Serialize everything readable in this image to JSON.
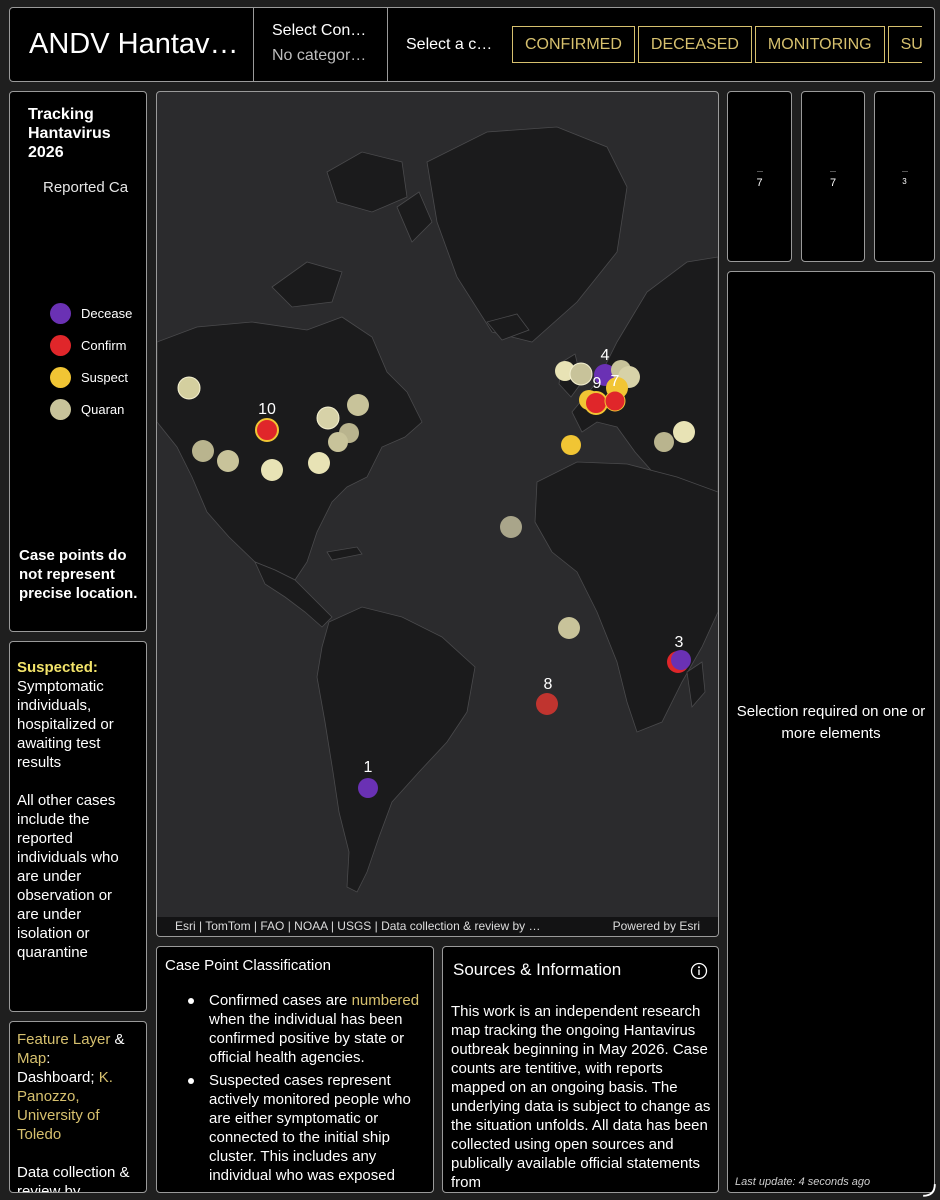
{
  "header": {
    "title": "ANDV Hantav…",
    "selector_one": {
      "label": "Select Con…",
      "value": "No categor…"
    },
    "selector_two": {
      "label": "Select a c…"
    },
    "category_buttons": [
      "CONFIRMED",
      "DECEASED",
      "MONITORING",
      "SUS"
    ]
  },
  "legend": {
    "title": "Tracking Hantavirus 2026",
    "heading": "Reported Ca",
    "items": [
      {
        "label": "Decease",
        "color": "#6a31b4"
      },
      {
        "label": "Confirm",
        "color": "#e0262a"
      },
      {
        "label": "Suspect",
        "color": "#f1c534"
      },
      {
        "label": "Quaran",
        "color": "#c8c39a"
      }
    ],
    "disclaimer": "Case points do not represent precise location."
  },
  "definition": {
    "term": "Suspected:",
    "description": "Symptomatic individuals, hospitalized or awaiting test results",
    "other_cases": "All other cases include the reported individuals who are under observation or are under isolation or quarantine"
  },
  "credits": {
    "feature_layer": "Feature Layer",
    "amp": " & ",
    "map": "Map",
    "colon": ":",
    "dashboard_prefix": " Dashboard; ",
    "author": "K. Panozzo, University of Toledo",
    "data_collection": "Data collection & review by"
  },
  "map": {
    "attribution": "Esri | TomTom | FAO | NOAA | USGS | Data collection & review by …",
    "powered_by": "Powered by Esri",
    "labels": [
      {
        "text": "10"
      },
      {
        "text": "4"
      },
      {
        "text": "9"
      },
      {
        "text": "7"
      },
      {
        "text": "3"
      },
      {
        "text": "8"
      },
      {
        "text": "1"
      }
    ]
  },
  "classification": {
    "title": "Case Point Classification",
    "item_one_prefix": "Confirmed cases are ",
    "item_one_highlight": "numbered",
    "item_one_suffix": " when the individual has been confirmed positive by state or official health agencies.",
    "item_two": "Suspected cases represent actively monitored people who are either symptomatic or connected to the initial ship cluster. This includes any individual who was exposed"
  },
  "sources": {
    "title": "Sources & Information",
    "body": "This work is an independent research map tracking the ongoing Hantavirus outbreak beginning in May 2026. Case counts are tentitive, with reports mapped on an ongoing basis. The underlying data is subject to change as the situation unfolds. All data has been collected using open sources and publically available official statements from"
  },
  "counters": [
    {
      "value": "7"
    },
    {
      "value": "7"
    },
    {
      "value": "3"
    }
  ],
  "details": {
    "message": "Selection required on one or more elements",
    "last_update": "Last update: 4 seconds ago"
  },
  "colors": {
    "accent_gold": "#d6c06e",
    "suspected_yellow": "#f2e36a",
    "map_water": "#2b2b2d",
    "map_land": "#1b1b1c"
  }
}
